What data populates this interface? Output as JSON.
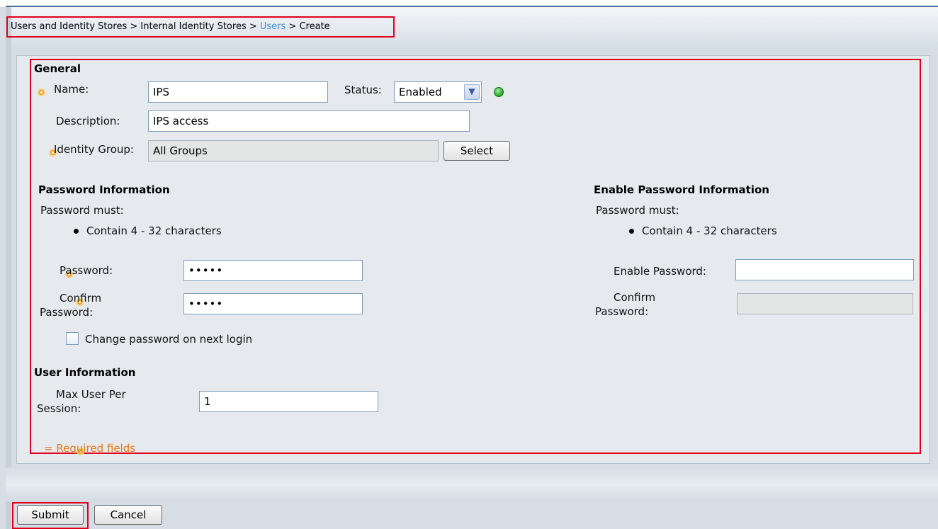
{
  "breadcrumb": {
    "part1": "Users and Identity Stores",
    "sep1": " > ",
    "part2": "Internal Identity Stores",
    "sep2": " > ",
    "part3": "Users",
    "sep3": " > ",
    "part4": "Create"
  },
  "general": {
    "heading": "General",
    "name_label": "Name:",
    "name_value": "IPS",
    "status_label": "Status:",
    "status_value": "Enabled",
    "description_label": "Description:",
    "description_value": "IPS access",
    "identity_group_label": "Identity Group:",
    "identity_group_value": "All Groups",
    "select_button": "Select"
  },
  "password": {
    "heading": "Password Information",
    "must_label": "Password must:",
    "rule": "Contain 4 - 32 characters",
    "password_label": "Password:",
    "password_value": "•••••",
    "confirm_label_line1": "Confirm",
    "confirm_label_line2": "Password:",
    "confirm_value": "•••••",
    "change_checkbox_label": "Change password on next login",
    "change_checked": false
  },
  "enable_password": {
    "heading": "Enable Password Information",
    "must_label": "Password must:",
    "rule": "Contain 4 - 32 characters",
    "password_label": "Enable Password:",
    "password_value": "",
    "confirm_label_line1": "Confirm",
    "confirm_label_line2": "Password:",
    "confirm_value": ""
  },
  "user_info": {
    "heading": "User Information",
    "max_label_line1": "Max User Per",
    "max_label_line2": "Session:",
    "max_value": "1"
  },
  "required_note": "= Required fields",
  "actions": {
    "submit": "Submit",
    "cancel": "Cancel"
  },
  "colors": {
    "highlight_border": "#e0001b",
    "link": "#3a8fd1",
    "required_icon": "#f0a020",
    "status_enabled": "#21a021"
  }
}
